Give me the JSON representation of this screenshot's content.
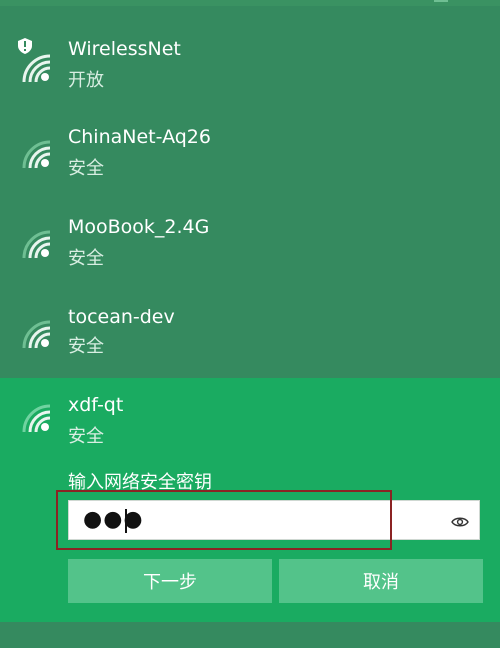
{
  "networks": [
    {
      "ssid": "WirelessNet",
      "status": "开放",
      "icon": "wifi-icon",
      "badge": "shield-alert-icon"
    },
    {
      "ssid": "ChinaNet-Aq26",
      "status": "安全",
      "icon": "wifi-icon"
    },
    {
      "ssid": "MooBook_2.4G",
      "status": "安全",
      "icon": "wifi-icon"
    },
    {
      "ssid": "tocean-dev",
      "status": "安全",
      "icon": "wifi-icon"
    },
    {
      "ssid": "xdf-qt",
      "status": "安全",
      "icon": "wifi-icon"
    }
  ],
  "connect": {
    "password_label": "输入网络安全密钥",
    "password_value": "●●●",
    "reveal_icon": "eye-icon",
    "next_label": "下一步",
    "cancel_label": "取消"
  },
  "colors": {
    "background": "#358a5f",
    "selected_background": "#1aab61",
    "button_background": "#53c38a",
    "highlight_border": "#8b2323"
  }
}
